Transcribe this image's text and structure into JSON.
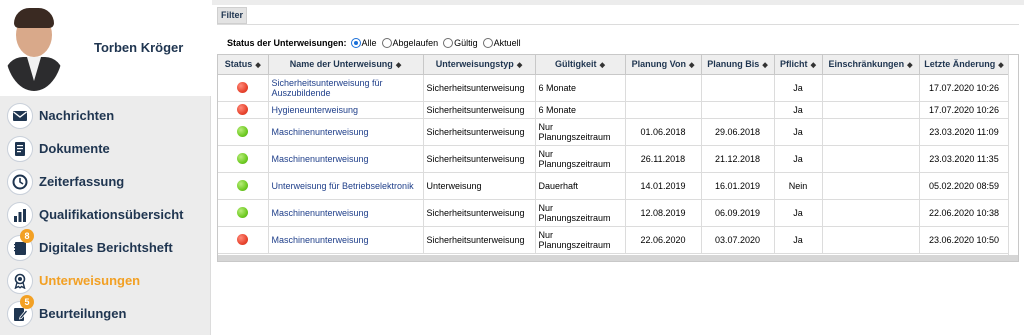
{
  "user": {
    "name": "Torben Kröger"
  },
  "nav": [
    {
      "label": "Nachrichten",
      "icon": "envelope-icon",
      "badge": ""
    },
    {
      "label": "Dokumente",
      "icon": "document-icon",
      "badge": ""
    },
    {
      "label": "Zeiterfassung",
      "icon": "clock-icon",
      "badge": ""
    },
    {
      "label": "Qualifikationsübersicht",
      "icon": "bar-chart-icon",
      "badge": ""
    },
    {
      "label": "Digitales Berichtsheft",
      "icon": "notebook-icon",
      "badge": "8"
    },
    {
      "label": "Unterweisungen",
      "icon": "award-icon",
      "badge": "",
      "active": true
    },
    {
      "label": "Beurteilungen",
      "icon": "edit-document-icon",
      "badge": "5"
    }
  ],
  "filter": {
    "tab_label": "Filter",
    "status_label": "Status der Unterweisungen:",
    "options": [
      "Alle",
      "Abgelaufen",
      "Gültig",
      "Aktuell"
    ],
    "selected": "Alle"
  },
  "table": {
    "columns": [
      "Status",
      "Name der Unterweisung",
      "Unterweisungstyp",
      "Gültigkeit",
      "Planung Von",
      "Planung Bis",
      "Pflicht",
      "Einschränkungen",
      "Letzte Änderung"
    ],
    "rows": [
      {
        "status": "red",
        "name": "Sicherheitsunterweisung für Auszubildende",
        "type": "Sicherheitsunterweisung",
        "validity": "6 Monate",
        "from": "",
        "to": "",
        "mandatory": "Ja",
        "restrictions": "",
        "changed": "17.07.2020 10:26"
      },
      {
        "status": "red",
        "name": "Hygieneunterweisung",
        "type": "Sicherheitsunterweisung",
        "validity": "6 Monate",
        "from": "",
        "to": "",
        "mandatory": "Ja",
        "restrictions": "",
        "changed": "17.07.2020 10:26"
      },
      {
        "status": "green",
        "name": "Maschinenunterweisung",
        "type": "Sicherheitsunterweisung",
        "validity": "Nur Planungszeitraum",
        "from": "01.06.2018",
        "to": "29.06.2018",
        "mandatory": "Ja",
        "restrictions": "",
        "changed": "23.03.2020 11:09"
      },
      {
        "status": "green",
        "name": "Maschinenunterweisung",
        "type": "Sicherheitsunterweisung",
        "validity": "Nur Planungszeitraum",
        "from": "26.11.2018",
        "to": "21.12.2018",
        "mandatory": "Ja",
        "restrictions": "",
        "changed": "23.03.2020 11:35"
      },
      {
        "status": "green",
        "name": "Unterweisung für Betriebselektronik",
        "type": "Unterweisung",
        "validity": "Dauerhaft",
        "from": "14.01.2019",
        "to": "16.01.2019",
        "mandatory": "Nein",
        "restrictions": "",
        "changed": "05.02.2020 08:59"
      },
      {
        "status": "green",
        "name": "Maschinenunterweisung",
        "type": "Sicherheitsunterweisung",
        "validity": "Nur Planungszeitraum",
        "from": "12.08.2019",
        "to": "06.09.2019",
        "mandatory": "Ja",
        "restrictions": "",
        "changed": "22.06.2020 10:38"
      },
      {
        "status": "red",
        "name": "Maschinenunterweisung",
        "type": "Sicherheitsunterweisung",
        "validity": "Nur Planungszeitraum",
        "from": "22.06.2020",
        "to": "03.07.2020",
        "mandatory": "Ja",
        "restrictions": "",
        "changed": "23.06.2020 10:50"
      }
    ]
  },
  "colors": {
    "accent": "#f2a024",
    "nav_text": "#1f3550",
    "link": "#1f3f8a",
    "status_red": "#e8452f",
    "status_green": "#6fcb23"
  }
}
